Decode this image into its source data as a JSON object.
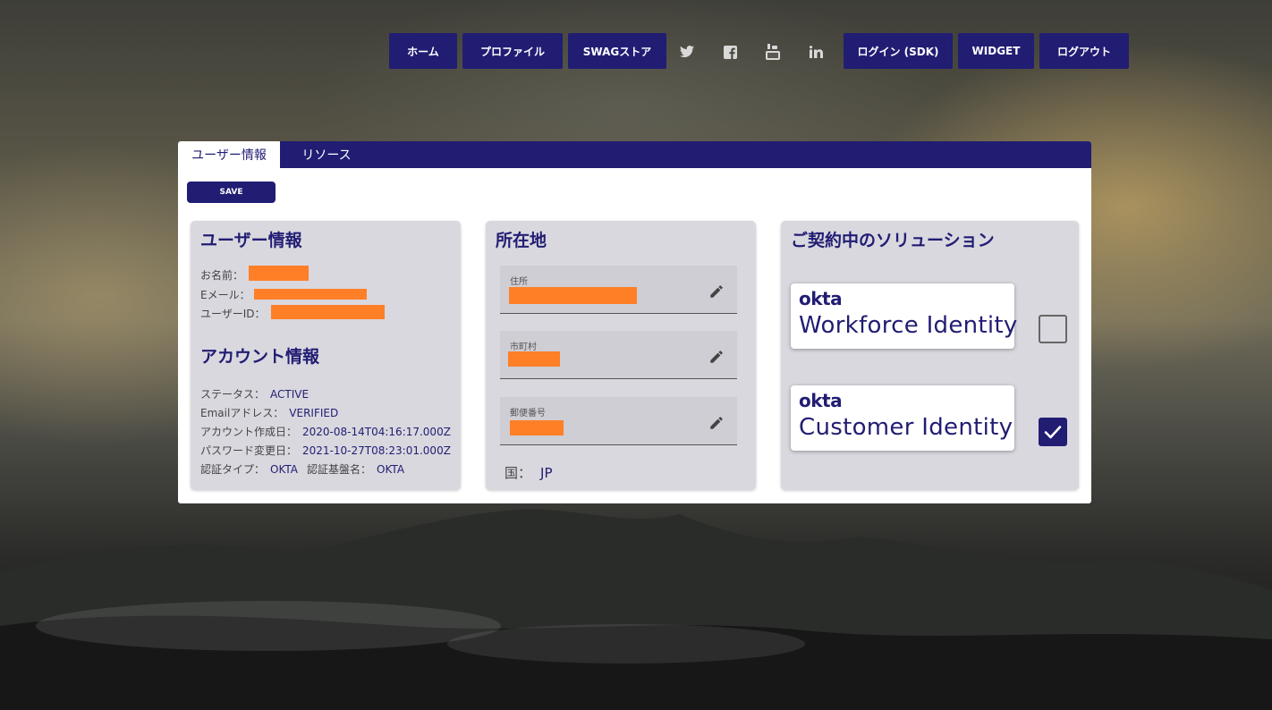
{
  "nav": {
    "home": "ホーム",
    "profile": "プロファイル",
    "swag_store": "SWAGストア",
    "login_sdk": "ログイン (SDK)",
    "widget": "WIDGET",
    "logout": "ログアウト",
    "icons": [
      "twitter-icon",
      "facebook-icon",
      "youtube-icon",
      "linkedin-icon"
    ]
  },
  "tabs": {
    "user_info": "ユーザー情報",
    "resources": "リソース"
  },
  "save_label": "SAVE",
  "user_panel": {
    "title": "ユーザー情報",
    "name_label": "お名前：",
    "email_label": "Eメール：",
    "userid_label": "ユーザーID：",
    "account_title": "アカウント情報",
    "status_label": "ステータス：",
    "status_value": "ACTIVE",
    "email_status_label": "Emailアドレス：",
    "email_status_value": "VERIFIED",
    "created_label": "アカウント作成日：",
    "created_value": "2020-08-14T04:16:17.000Z",
    "pw_changed_label": "パスワード変更日：",
    "pw_changed_value": "2021-10-27T08:23:01.000Z",
    "auth_type_label": "認証タイプ：",
    "auth_type_value": "OKTA",
    "auth_base_label": "認証基盤名：",
    "auth_base_value": "OKTA"
  },
  "address_panel": {
    "title": "所在地",
    "address_label": "住所",
    "city_label": "市町村",
    "postal_label": "郵便番号",
    "country_label": "国：",
    "country_value": "JP"
  },
  "solutions_panel": {
    "title": "ご契約中のソリューション",
    "items": [
      {
        "logo": "okta",
        "name": "Workforce Identity",
        "checked": false
      },
      {
        "logo": "okta",
        "name": "Customer Identity",
        "checked": true
      }
    ]
  },
  "colors": {
    "brand": "#211d73",
    "redaction": "#ff7f27",
    "panel": "#d9d8df"
  }
}
